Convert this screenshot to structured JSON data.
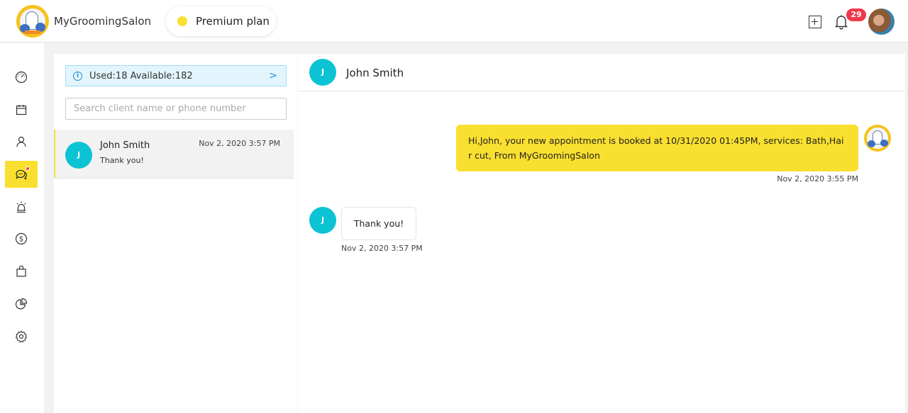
{
  "header": {
    "brand_name": "MyGroomingSalon",
    "plan_label": "Premium plan",
    "plan_dot_color": "#f9df2f",
    "notification_count": "29",
    "icons": [
      "add-icon",
      "bell-icon",
      "user-avatar"
    ]
  },
  "sidebar": {
    "items": [
      {
        "name": "dashboard",
        "icon": "speedometer-icon",
        "active": false
      },
      {
        "name": "calendar",
        "icon": "calendar-icon",
        "active": false
      },
      {
        "name": "clients",
        "icon": "person-icon",
        "active": false
      },
      {
        "name": "messages",
        "icon": "chat-icon",
        "active": true,
        "has_notification": true
      },
      {
        "name": "alerts",
        "icon": "alarm-icon",
        "active": false
      },
      {
        "name": "payments",
        "icon": "dollar-icon",
        "active": false
      },
      {
        "name": "shop",
        "icon": "bag-icon",
        "active": false
      },
      {
        "name": "reports",
        "icon": "pie-chart-icon",
        "active": false
      },
      {
        "name": "settings",
        "icon": "gear-icon",
        "active": false
      }
    ],
    "accent_color": "#f9df2f"
  },
  "conversation_list": {
    "quota_text": "Used:18 Available:182",
    "search_placeholder": "Search client name or phone number",
    "search_value": "",
    "items": [
      {
        "initial": "J",
        "name": "John Smith",
        "preview": "Thank you!",
        "time": "Nov 2, 2020 3:57 PM",
        "selected": true
      }
    ]
  },
  "chat": {
    "contact_initial": "J",
    "contact_name": "John Smith",
    "messages": [
      {
        "direction": "outgoing",
        "text": "Hi,John, your new appointment is booked at 10/31/2020 01:45PM, services: Bath,Hair cut, From MyGroomingSalon",
        "time": "Nov 2, 2020 3:55 PM"
      },
      {
        "direction": "incoming",
        "initial": "J",
        "text": "Thank you!",
        "time": "Nov 2, 2020 3:57 PM"
      }
    ]
  }
}
